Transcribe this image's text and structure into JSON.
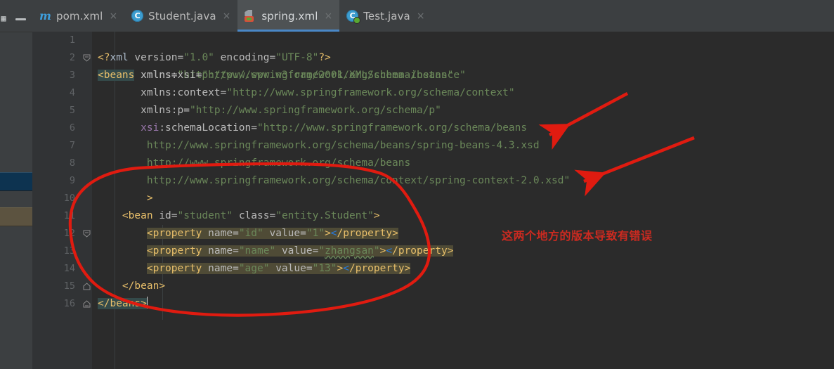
{
  "window": {
    "theme_bg": "#2b2b2b",
    "chrome_bg": "#3c3f41",
    "accent": "#4a88c7"
  },
  "left_strip": {
    "minimize_label": "—",
    "partial_icon": "project-icon",
    "bars": [
      {
        "name": "strip-bar-blue",
        "color": "#0d3350"
      },
      {
        "name": "strip-bar-tan",
        "color": "#5c5340"
      }
    ]
  },
  "tabs": [
    {
      "label": "pom.xml",
      "icon": "maven-icon",
      "close": "×",
      "active": false
    },
    {
      "label": "Student.java",
      "icon": "class-icon",
      "close": "×",
      "active": false,
      "icon_letter": "C"
    },
    {
      "label": "spring.xml",
      "icon": "spring-icon",
      "close": "×",
      "active": true
    },
    {
      "label": "Test.java",
      "icon": "test-class-icon",
      "close": "×",
      "active": false,
      "icon_letter": "C"
    }
  ],
  "editor": {
    "filename": "spring.xml",
    "line_numbers": [
      "1",
      "2",
      "3",
      "4",
      "5",
      "6",
      "7",
      "8",
      "9",
      "10",
      "11",
      "12",
      "13",
      "14",
      "15",
      "16"
    ],
    "lines": [
      {
        "n": "1",
        "text": "<?xml version=\"1.0\" encoding=\"UTF-8\"?>"
      },
      {
        "n": "2",
        "text": "<beans xmlns=\"http://www.springframework.org/schema/beans\""
      },
      {
        "n": "3",
        "text": "       xmlns:xsi=\"http://www.w3.org/2001/XMLSchema-instance\""
      },
      {
        "n": "4",
        "text": "       xmlns:context=\"http://www.springframework.org/schema/context\""
      },
      {
        "n": "5",
        "text": "       xmlns:p=\"http://www.springframework.org/schema/p\""
      },
      {
        "n": "6",
        "text": "       xsi:schemaLocation=\"http://www.springframework.org/schema/beans"
      },
      {
        "n": "7",
        "text": "        http://www.springframework.org/schema/beans/spring-beans-4.3.xsd"
      },
      {
        "n": "8",
        "text": "        http://www.springframework.org/schema/beans"
      },
      {
        "n": "9",
        "text": "        http://www.springframework.org/schema/context/spring-context-2.0.xsd\""
      },
      {
        "n": "10",
        "text": "        >"
      },
      {
        "n": "11",
        "text": "    <bean id=\"student\" class=\"entity.Student\">"
      },
      {
        "n": "12",
        "text": "        <property name=\"id\" value=\"1\"></property>"
      },
      {
        "n": "13",
        "text": "        <property name=\"name\" value=\"zhangsan\"></property>"
      },
      {
        "n": "14",
        "text": "        <property name=\"age\" value=\"13\"></property>"
      },
      {
        "n": "15",
        "text": "    </bean>"
      },
      {
        "n": "16",
        "text": "</beans>"
      }
    ],
    "tokens": {
      "pi_open": "<?",
      "pi_name": "xml",
      "attr_version": "version",
      "val_version": "\"1.0\"",
      "attr_encoding": "encoding",
      "val_encoding": "\"UTF-8\"",
      "pi_close": "?>",
      "tag_beans_open": "<beans",
      "attr_xmlns": "xmlns",
      "val_xmlns_beans": "\"http://www.springframework.org/schema/beans\"",
      "attr_xmlns_xsi": "xmlns:xsi",
      "val_xsi": "\"http://www.w3.org/2001/XMLSchema-instance\"",
      "attr_xmlns_context": "xmlns:context",
      "val_context": "\"http://www.springframework.org/schema/context\"",
      "attr_xmlns_p": "xmlns:p",
      "val_p": "\"http://www.springframework.org/schema/p\"",
      "attr_schemaloc_ns": "xsi",
      "attr_schemaloc": ":schemaLocation",
      "val_sl_1": "\"http://www.springframework.org/schema/beans",
      "val_sl_2": "http://www.springframework.org/schema/beans/spring-beans-4.3.xsd",
      "val_sl_3": "http://www.springframework.org/schema/beans",
      "val_sl_4": "http://www.springframework.org/schema/context/spring-context-2.0.xsd\"",
      "gt": ">",
      "tag_bean_open": "<bean",
      "attr_id": "id",
      "val_id_student": "\"student\"",
      "attr_class": "class",
      "val_class_student": "\"entity.Student\"",
      "tag_property_open": "<property",
      "attr_name": "name",
      "val_name_id": "\"id\"",
      "attr_value": "value",
      "val_value_1": "\"1\"",
      "val_name_name": "\"name\"",
      "val_value_zhangsan": "zhangsan",
      "val_name_age": "\"age\"",
      "val_value_13": "\"13\"",
      "tag_property_close": "</property",
      "tag_bean_close": "</bean",
      "tag_beans_close": "</beans",
      "eq": "=",
      "quote": "\"",
      "lt": "<"
    }
  },
  "annotations": {
    "note_text": "这两个地方的版本导致有错误",
    "note_color": "#cc2a20",
    "arrows": [
      {
        "name": "arrow-to-schema-beans",
        "color": "#e01b10"
      },
      {
        "name": "arrow-to-spring-context",
        "color": "#e01b10"
      }
    ],
    "circle": {
      "name": "red-circle-highlight",
      "color": "#e01b10"
    }
  }
}
